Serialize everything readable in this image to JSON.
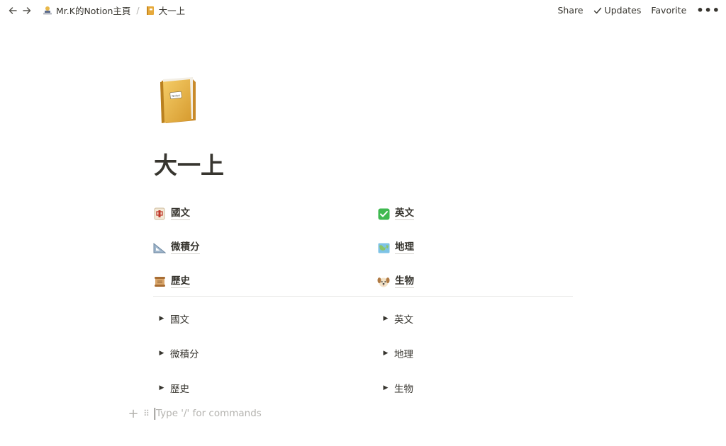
{
  "topbar": {
    "breadcrumbs": [
      {
        "label": "Mr.K的Notion主頁",
        "icon": "person-laptop-icon"
      },
      {
        "label": "大一上",
        "icon": "notebook-icon"
      }
    ],
    "separator": "/",
    "share": "Share",
    "updates": "Updates",
    "favorite": "Favorite",
    "more": "•••"
  },
  "page": {
    "icon": "notebook-icon",
    "title": "大一上"
  },
  "links": [
    {
      "label": "國文",
      "icon": "mahjong-tile-icon"
    },
    {
      "label": "英文",
      "icon": "check-mark-button-icon"
    },
    {
      "label": "微積分",
      "icon": "triangular-ruler-icon"
    },
    {
      "label": "地理",
      "icon": "world-map-icon"
    },
    {
      "label": "歷史",
      "icon": "scroll-icon"
    },
    {
      "label": "生物",
      "icon": "dog-face-icon"
    }
  ],
  "toggles": [
    {
      "label": "國文"
    },
    {
      "label": "英文"
    },
    {
      "label": "微積分"
    },
    {
      "label": "地理"
    },
    {
      "label": "歷史"
    },
    {
      "label": "生物"
    }
  ],
  "command": {
    "placeholder": "Type '/' for commands"
  }
}
